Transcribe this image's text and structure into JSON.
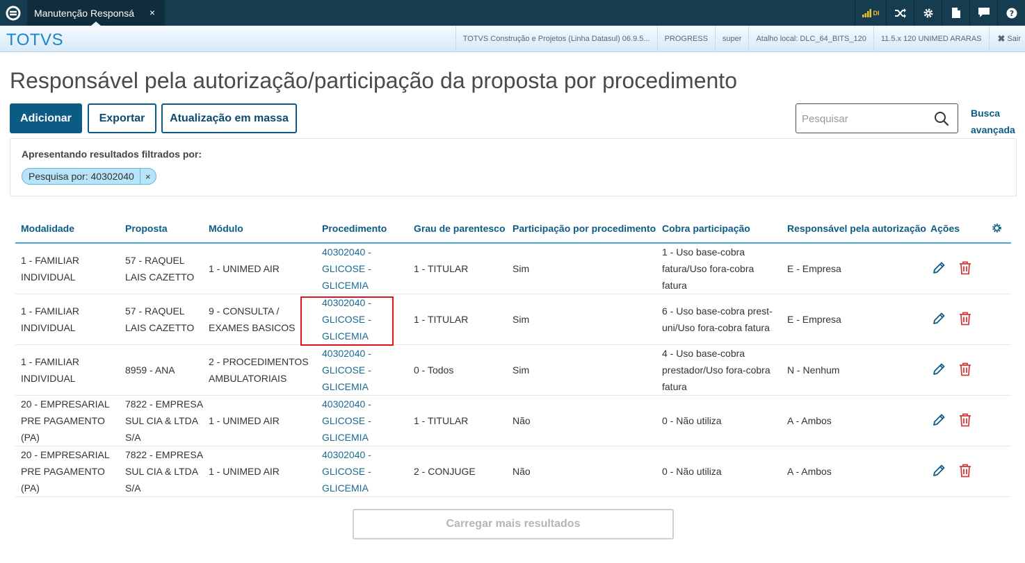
{
  "tab": {
    "label": "Manutenção Responsá",
    "close": "×"
  },
  "topbar": {
    "signal_text": "DI"
  },
  "brand": "TOTVS",
  "info": {
    "product": "TOTVS Construção e Projetos (Linha Datasul) 06.9.5...",
    "db": "PROGRESS",
    "user": "super",
    "shortcut": "Atalho local: DLC_64_BITS_120",
    "version": "11.5.x 120 UNIMED ARARAS",
    "logout": "Sair"
  },
  "page_title": "Responsável pela autorização/participação da proposta por procedimento",
  "buttons": {
    "add": "Adicionar",
    "export": "Exportar",
    "mass_update": "Atualização em massa"
  },
  "search": {
    "placeholder": "Pesquisar",
    "advanced": "Busca avançada"
  },
  "filter": {
    "title": "Apresentando resultados filtrados por:",
    "chip": "Pesquisa por: 40302040",
    "chip_close": "×"
  },
  "table": {
    "headers": [
      "Modalidade",
      "Proposta",
      "Módulo",
      "Procedimento",
      "Grau de parentesco",
      "Participação por procedimento",
      "Cobra participação",
      "Responsável pela autorização",
      "Ações"
    ],
    "rows": [
      [
        "1 - FAMILIAR INDIVIDUAL",
        "57 - RAQUEL LAIS CAZETTO",
        "1 - UNIMED AIR",
        "40302040 - GLICOSE - GLICEMIA",
        "1 - TITULAR",
        "Sim",
        "1 - Uso base-cobra fatura/Uso fora-cobra fatura",
        "E - Empresa"
      ],
      [
        "1 - FAMILIAR INDIVIDUAL",
        "57 - RAQUEL LAIS CAZETTO",
        "9 - CONSULTA / EXAMES BASICOS",
        "40302040 - GLICOSE - GLICEMIA",
        "1 - TITULAR",
        "Sim",
        "6 - Uso base-cobra prest-uni/Uso fora-cobra fatura",
        "E - Empresa"
      ],
      [
        "1 - FAMILIAR INDIVIDUAL",
        "8959 - ANA",
        "2 - PROCEDIMENTOS AMBULATORIAIS",
        "40302040 - GLICOSE - GLICEMIA",
        "0 - Todos",
        "Sim",
        "4 - Uso base-cobra prestador/Uso fora-cobra fatura",
        "N - Nenhum"
      ],
      [
        "20 - EMPRESARIAL PRE PAGAMENTO (PA)",
        "7822 - EMPRESA SUL CIA & LTDA S/A",
        "1 - UNIMED AIR",
        "40302040 - GLICOSE - GLICEMIA",
        "1 - TITULAR",
        "Não",
        "0 - Não utiliza",
        "A - Ambos"
      ],
      [
        "20 - EMPRESARIAL PRE PAGAMENTO (PA)",
        "7822 - EMPRESA SUL CIA & LTDA S/A",
        "1 - UNIMED AIR",
        "40302040 - GLICOSE - GLICEMIA",
        "2 - CONJUGE",
        "Não",
        "0 - Não utiliza",
        "A - Ambos"
      ]
    ]
  },
  "load_more": "Carregar mais resultados",
  "colors": {
    "primary": "#0c5b85",
    "topbar": "#163c4f",
    "delete": "#d33b3b",
    "highlight": "#e0151e"
  }
}
